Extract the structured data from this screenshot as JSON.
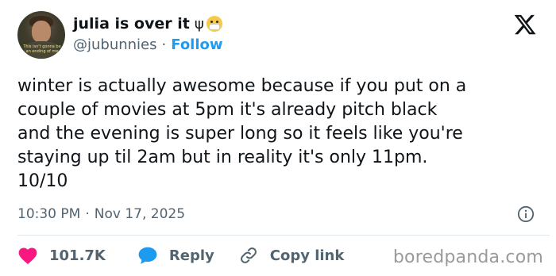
{
  "author": {
    "display_name": "julia is over it",
    "name_symbol": "ψ",
    "status_emoji": "face-with-medical-mask",
    "handle": "@jubunnies",
    "separator": "·",
    "follow_label": "Follow",
    "avatar_caption": "This isn't gonna be an ending of me"
  },
  "tweet": {
    "text": "winter is actually awesome because if you put on a\ncouple of movies at 5pm it's already pitch black\nand the evening is super long so it feels like you're\nstaying up til 2am but in reality it's only 11pm.\n10/10",
    "time": "10:30 PM",
    "separator": "·",
    "date": "Nov 17, 2025"
  },
  "actions": {
    "like_count": "101.7K",
    "reply_label": "Reply",
    "copy_link_label": "Copy link"
  },
  "watermark": "boredpanda.com",
  "colors": {
    "accent": "#1d9bf0",
    "like": "#f91880",
    "text": "#0f1419",
    "muted": "#536471"
  },
  "icons": [
    "x-logo-icon",
    "info-icon",
    "heart-icon",
    "reply-bubble-icon",
    "link-icon"
  ]
}
